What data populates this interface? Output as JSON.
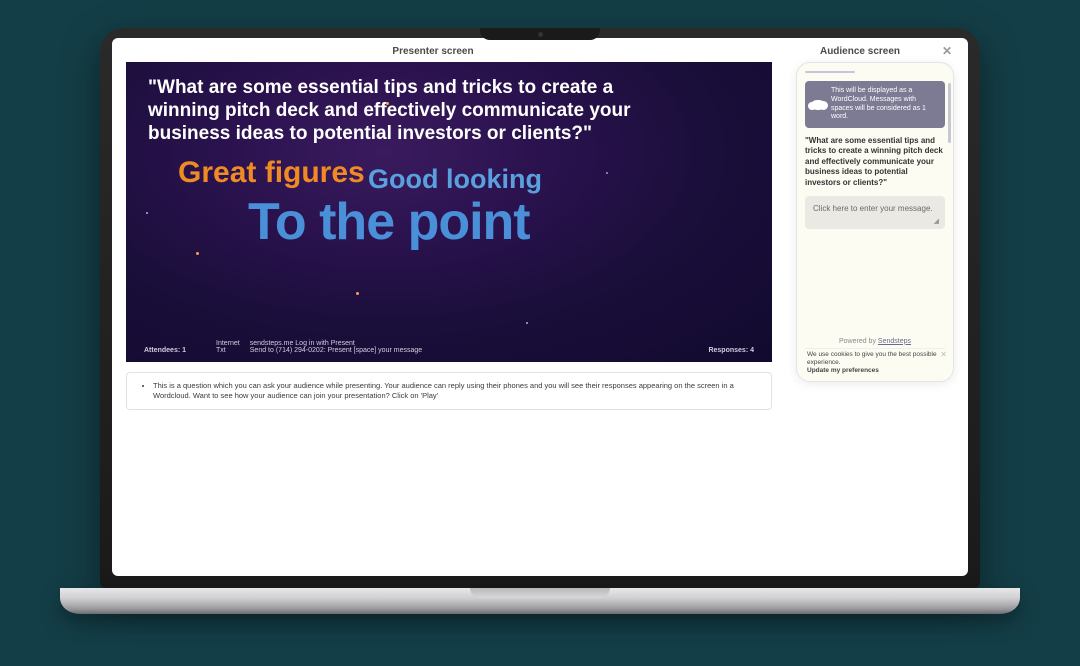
{
  "titles": {
    "presenter": "Presenter screen",
    "audience": "Audience screen"
  },
  "slide": {
    "question": "\"What are some essential tips and tricks to create a winning pitch deck and effectively communicate your business ideas to potential investors or clients?\"",
    "wordcloud": {
      "w1": "Great figures",
      "w2": "Good looking",
      "w3": "To the point"
    },
    "footer": {
      "attendees_label": "Attendees: 1",
      "col_internet": "Internet",
      "col_txt": "Txt",
      "line_login": "sendsteps.me Log in with Present",
      "line_send": "Send to (714) 294-0202: Present [space] your message",
      "responses_label": "Responses: 4"
    }
  },
  "hint": "This is a question which you can ask your audience while presenting. Your audience can reply using their phones and you will see their responses appearing on the screen in a Wordcloud. Want to see how your audience can join your presentation? Click on 'Play'",
  "audience": {
    "banner": "This will be displayed as a WordCloud. Messages with spaces will be considered as 1 word.",
    "question": "\"What are some essential tips and tricks to create a winning pitch deck and effectively communicate your business ideas to potential investors or clients?\"",
    "input_placeholder": "Click here to enter your message.",
    "powered_prefix": "Powered by ",
    "powered_brand": "Sendsteps",
    "cookie_text": "We use cookies to give you the best possible experience.",
    "cookie_pref": "Update my preferences"
  }
}
